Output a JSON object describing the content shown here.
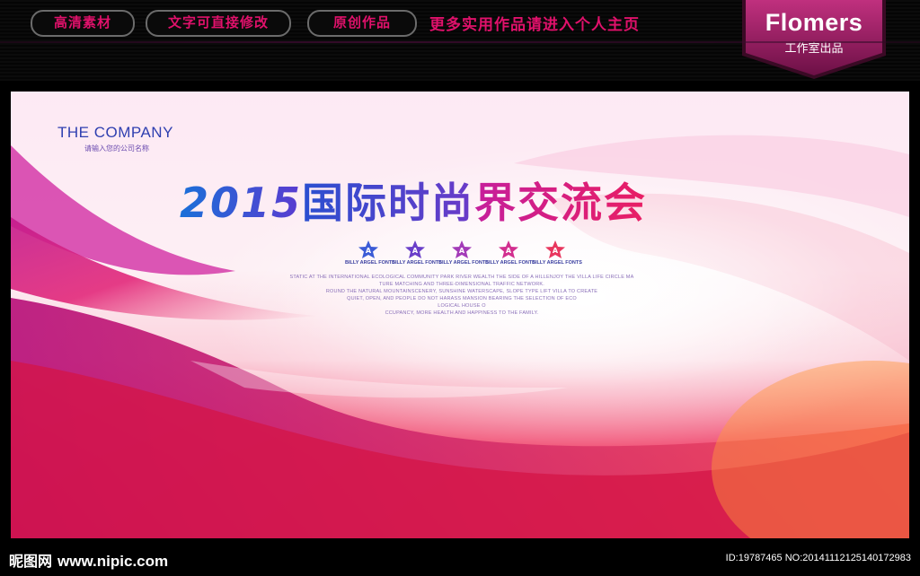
{
  "topbar": {
    "tags": [
      "高清素材",
      "文字可直接修改",
      "原创作品"
    ],
    "more_link": "更多实用作品请进入个人主页",
    "brand": {
      "name": "Flomers",
      "sub": "工作室出品"
    }
  },
  "banner": {
    "company": "THE COMPANY",
    "company_sub": "请输入您的公司名称",
    "title_year": "2015",
    "title_part1": "国际时尚",
    "title_part2": "界交流会",
    "stars": [
      {
        "letter": "A",
        "caption": "BILLY ARGEL FONTS",
        "color": "#3b5bd6"
      },
      {
        "letter": "A",
        "caption": "BILLY ARGEL FONTS",
        "color": "#6a3fc9"
      },
      {
        "letter": "A",
        "caption": "BILLY ARGEL FONTS",
        "color": "#a33bb8"
      },
      {
        "letter": "A",
        "caption": "BILLY ARGEL FONTS",
        "color": "#d22f8f"
      },
      {
        "letter": "A",
        "caption": "BILLY ARGEL FONTS",
        "color": "#e8365e"
      }
    ],
    "fine_print": [
      "STATIC AT THE INTERNATIONAL ECOLOGICAL COMMUNITY PARK RIVER WEALTH THE SIDE OF A HILLENJOY THE VILLA LIFE CIRCLE MA",
      "TURE MATCHING AND THREE-DIMENSIONAL TRAFFIC NETWORK.",
      "ROUND THE NATURAL MOUNTAINSCENERY, SUNSHINE WATERSCAPE, SLOPE TYPE LIFT VILLA TO CREATE",
      "QUIET, OPEN, AND PEOPLE DO NOT HARASS MANSION BEARING THE SELECTION OF ECO",
      "LOGICAL HOUSE O",
      "CCUPANCY, MORE HEALTH AND HAPPINESS TO THE FAMILY."
    ]
  },
  "watermark": {
    "site_cn": "昵图网",
    "site_url": "www.nipic.com",
    "id_text": "ID:19787465 NO:20141112125140172983"
  },
  "colors": {
    "accent": "#e0116b",
    "brand_bg": "#8a1a5a"
  }
}
